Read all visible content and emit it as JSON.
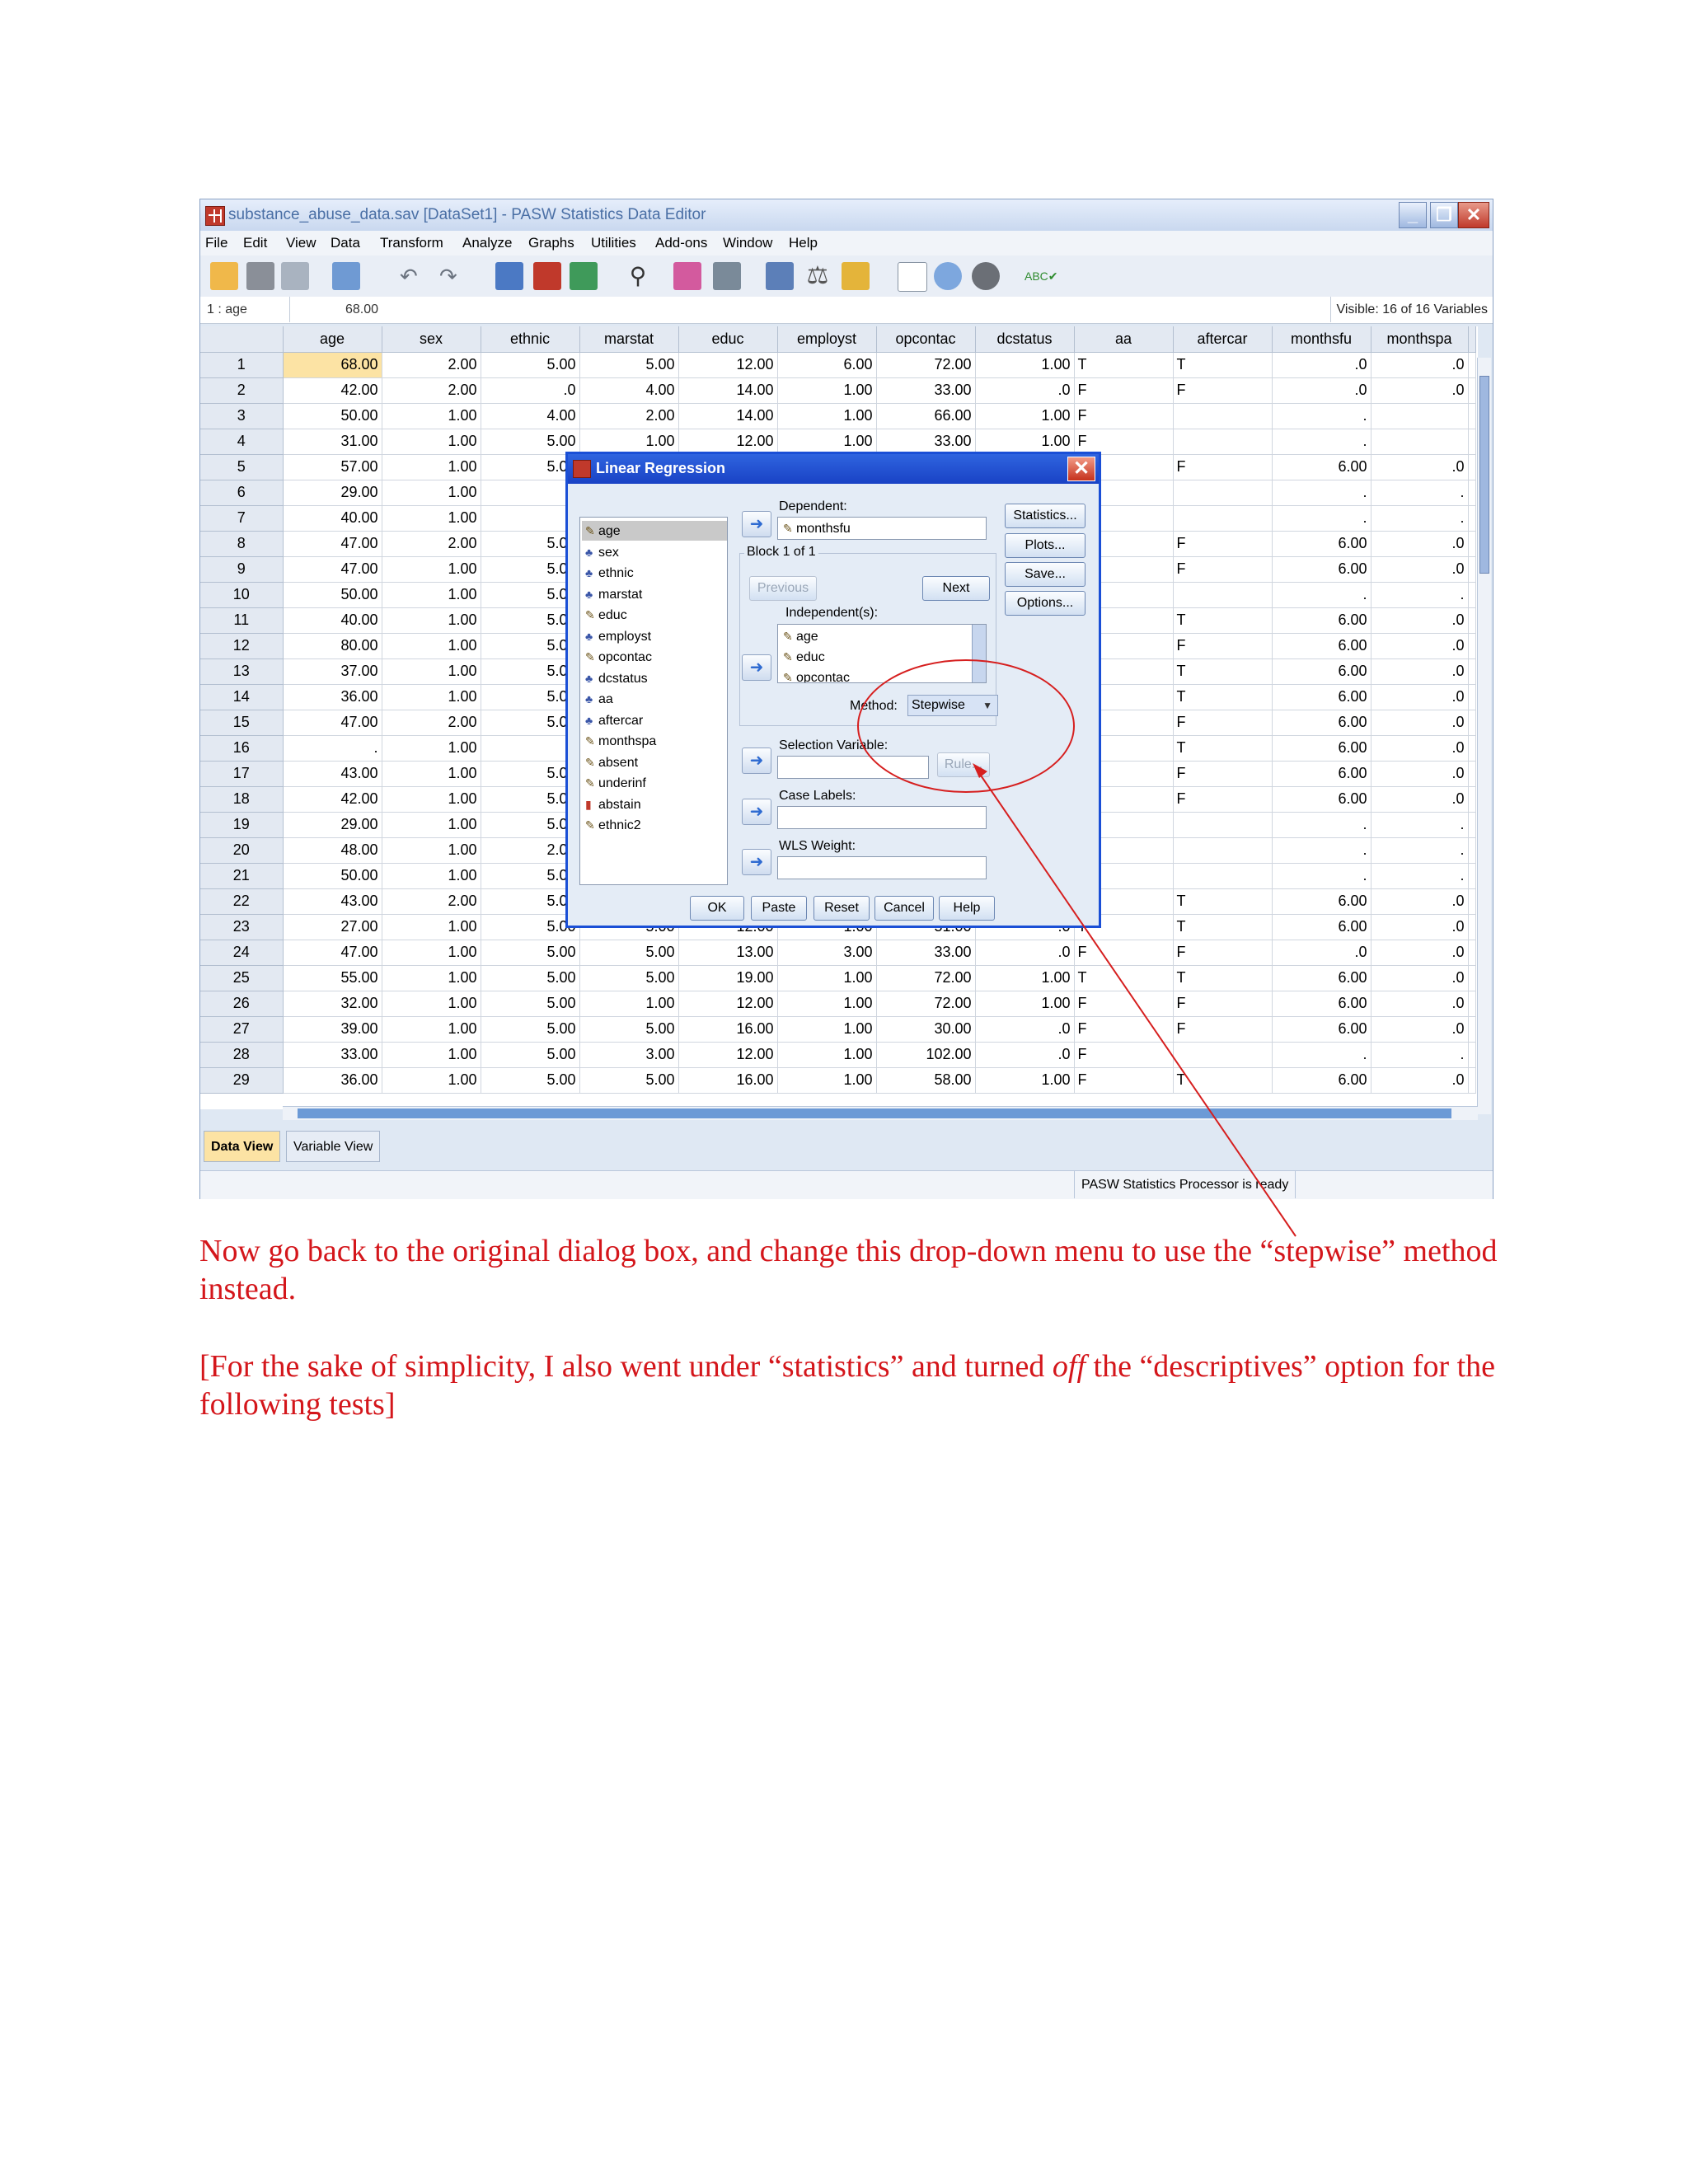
{
  "window": {
    "title": "substance_abuse_data.sav [DataSet1] - PASW Statistics Data Editor"
  },
  "menu": [
    "File",
    "Edit",
    "View",
    "Data",
    "Transform",
    "Analyze",
    "Graphs",
    "Utilities",
    "Add-ons",
    "Window",
    "Help"
  ],
  "toolbar_icons": [
    "open-icon",
    "save-icon",
    "print-icon",
    "dialog-recall-icon",
    "undo-icon",
    "redo-icon",
    "goto-case-icon",
    "goto-variable-icon",
    "variables-icon",
    "find-icon",
    "insert-cases-icon",
    "insert-variable-icon",
    "split-file-icon",
    "weight-cases-icon",
    "select-cases-icon",
    "value-labels-icon",
    "use-sets-icon",
    "show-all-icon",
    "spelling-icon"
  ],
  "cellbar": {
    "ref": "1 : age",
    "value": "68.00",
    "visible": "Visible: 16 of 16 Variables"
  },
  "columns": [
    "age",
    "sex",
    "ethnic",
    "marstat",
    "educ",
    "employst",
    "opcontac",
    "dcstatus",
    "aa",
    "aftercar",
    "monthsfu",
    "monthspa"
  ],
  "rows": [
    [
      "1",
      "68.00",
      "2.00",
      "5.00",
      "5.00",
      "12.00",
      "6.00",
      "72.00",
      "1.00",
      "T",
      "T",
      ".0",
      ".0"
    ],
    [
      "2",
      "42.00",
      "2.00",
      ".0",
      "4.00",
      "14.00",
      "1.00",
      "33.00",
      ".0",
      "F",
      "F",
      ".0",
      ".0"
    ],
    [
      "3",
      "50.00",
      "1.00",
      "4.00",
      "2.00",
      "14.00",
      "1.00",
      "66.00",
      "1.00",
      "F",
      "",
      ".",
      ""
    ],
    [
      "4",
      "31.00",
      "1.00",
      "5.00",
      "1.00",
      "12.00",
      "1.00",
      "33.00",
      "1.00",
      "F",
      "",
      ".",
      ""
    ],
    [
      "5",
      "57.00",
      "1.00",
      "5.00",
      "",
      "",
      "",
      "",
      "",
      "",
      "F",
      "6.00",
      ".0"
    ],
    [
      "6",
      "29.00",
      "1.00",
      "",
      "",
      "",
      "",
      "",
      "",
      "",
      "",
      ".",
      "."
    ],
    [
      "7",
      "40.00",
      "1.00",
      "",
      "",
      "",
      "",
      "",
      "",
      "",
      "",
      ".",
      "."
    ],
    [
      "8",
      "47.00",
      "2.00",
      "5.00",
      "",
      "",
      "",
      "",
      "",
      "",
      "F",
      "6.00",
      ".0"
    ],
    [
      "9",
      "47.00",
      "1.00",
      "5.00",
      "",
      "",
      "",
      "",
      "",
      "",
      "F",
      "6.00",
      ".0"
    ],
    [
      "10",
      "50.00",
      "1.00",
      "5.00",
      "",
      "",
      "",
      "",
      "",
      "",
      "",
      ".",
      "."
    ],
    [
      "11",
      "40.00",
      "1.00",
      "5.00",
      "",
      "",
      "",
      "",
      "",
      "",
      "T",
      "6.00",
      ".0"
    ],
    [
      "12",
      "80.00",
      "1.00",
      "5.00",
      "",
      "",
      "",
      "",
      "",
      "",
      "F",
      "6.00",
      ".0"
    ],
    [
      "13",
      "37.00",
      "1.00",
      "5.00",
      "",
      "",
      "",
      "",
      "",
      "",
      "T",
      "6.00",
      ".0"
    ],
    [
      "14",
      "36.00",
      "1.00",
      "5.00",
      "",
      "",
      "",
      "",
      "",
      "",
      "T",
      "6.00",
      ".0"
    ],
    [
      "15",
      "47.00",
      "2.00",
      "5.00",
      "",
      "",
      "",
      "",
      "",
      "",
      "F",
      "6.00",
      ".0"
    ],
    [
      "16",
      ".",
      "1.00",
      "",
      "",
      "",
      "",
      "",
      "",
      "",
      "T",
      "6.00",
      ".0"
    ],
    [
      "17",
      "43.00",
      "1.00",
      "5.00",
      "",
      "",
      "",
      "",
      "",
      "",
      "F",
      "6.00",
      ".0"
    ],
    [
      "18",
      "42.00",
      "1.00",
      "5.00",
      "",
      "",
      "",
      "",
      "",
      "",
      "F",
      "6.00",
      ".0"
    ],
    [
      "19",
      "29.00",
      "1.00",
      "5.00",
      "",
      "",
      "",
      "",
      "",
      "",
      "",
      ".",
      "."
    ],
    [
      "20",
      "48.00",
      "1.00",
      "2.00",
      "",
      "",
      "",
      "",
      "",
      "",
      "",
      ".",
      "."
    ],
    [
      "21",
      "50.00",
      "1.00",
      "5.00",
      "",
      "",
      "",
      "",
      "",
      "",
      "",
      ".",
      "."
    ],
    [
      "22",
      "43.00",
      "2.00",
      "5.00",
      "",
      "",
      "",
      "",
      "",
      "",
      "T",
      "6.00",
      ".0"
    ],
    [
      "23",
      "27.00",
      "1.00",
      "5.00",
      "5.00",
      "12.00",
      "1.00",
      "51.00",
      ".0",
      "T",
      "T",
      "6.00",
      ".0"
    ],
    [
      "24",
      "47.00",
      "1.00",
      "5.00",
      "5.00",
      "13.00",
      "3.00",
      "33.00",
      ".0",
      "F",
      "F",
      ".0",
      ".0"
    ],
    [
      "25",
      "55.00",
      "1.00",
      "5.00",
      "5.00",
      "19.00",
      "1.00",
      "72.00",
      "1.00",
      "T",
      "T",
      "6.00",
      ".0"
    ],
    [
      "26",
      "32.00",
      "1.00",
      "5.00",
      "1.00",
      "12.00",
      "1.00",
      "72.00",
      "1.00",
      "F",
      "F",
      "6.00",
      ".0"
    ],
    [
      "27",
      "39.00",
      "1.00",
      "5.00",
      "5.00",
      "16.00",
      "1.00",
      "30.00",
      ".0",
      "F",
      "F",
      "6.00",
      ".0"
    ],
    [
      "28",
      "33.00",
      "1.00",
      "5.00",
      "3.00",
      "12.00",
      "1.00",
      "102.00",
      ".0",
      "F",
      "",
      ".",
      "."
    ],
    [
      "29",
      "36.00",
      "1.00",
      "5.00",
      "5.00",
      "16.00",
      "1.00",
      "58.00",
      "1.00",
      "F",
      "T",
      "6.00",
      ".0"
    ]
  ],
  "tabs": {
    "data_view": "Data View",
    "variable_view": "Variable View"
  },
  "status": "PASW Statistics Processor is ready",
  "dialog": {
    "title": "Linear Regression",
    "variables": [
      {
        "name": "age",
        "type": "scale"
      },
      {
        "name": "sex",
        "type": "nominal"
      },
      {
        "name": "ethnic",
        "type": "nominal"
      },
      {
        "name": "marstat",
        "type": "nominal"
      },
      {
        "name": "educ",
        "type": "scale"
      },
      {
        "name": "employst",
        "type": "nominal"
      },
      {
        "name": "opcontac",
        "type": "scale"
      },
      {
        "name": "dcstatus",
        "type": "nominal"
      },
      {
        "name": "aa",
        "type": "nominal"
      },
      {
        "name": "aftercar",
        "type": "nominal"
      },
      {
        "name": "monthspa",
        "type": "scale"
      },
      {
        "name": "absent",
        "type": "scale"
      },
      {
        "name": "underinf",
        "type": "scale"
      },
      {
        "name": "abstain",
        "type": "ordinal"
      },
      {
        "name": "ethnic2",
        "type": "scale"
      }
    ],
    "dependent_label": "Dependent:",
    "dependent_value": "monthsfu",
    "block_label": "Block 1 of 1",
    "previous": "Previous",
    "next": "Next",
    "independent_label": "Independent(s):",
    "independents": [
      "age",
      "educ",
      "opcontac"
    ],
    "method_label": "Method:",
    "method_value": "Stepwise",
    "selection_label": "Selection Variable:",
    "rule": "Rule...",
    "case_labels": "Case Labels:",
    "wls_weight": "WLS Weight:",
    "side_buttons": [
      "Statistics...",
      "Plots...",
      "Save...",
      "Options..."
    ],
    "bottom_buttons": [
      "OK",
      "Paste",
      "Reset",
      "Cancel",
      "Help"
    ]
  },
  "caption": {
    "p1": "Now go back to the original dialog box, and change this drop-down menu to use the “stepwise” method instead.",
    "p2_a": "[For the sake of simplicity, I also went under “statistics” and turned ",
    "p2_em": "off",
    "p2_b": " the “descriptives” option for the following tests]"
  }
}
